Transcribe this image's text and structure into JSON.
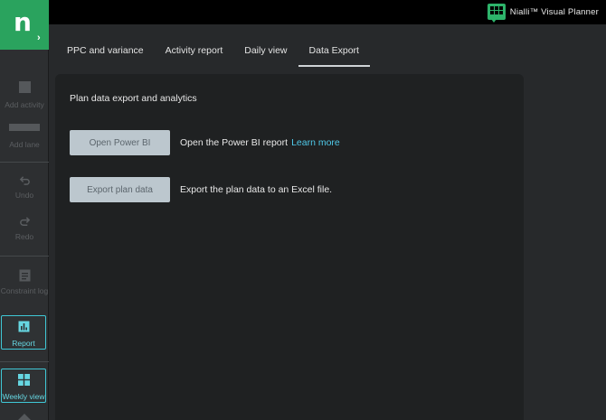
{
  "brand": {
    "name": "Nialli™ Visual Planner",
    "accent": "#2db36a"
  },
  "logo": {
    "letter": "n",
    "chevron": "›"
  },
  "sidebar": {
    "add_activity": "Add activity",
    "add_lane": "Add lane",
    "undo": "Undo",
    "redo": "Redo",
    "constraint_log": "Constraint log",
    "report": "Report",
    "weekly_view": "Weekly view"
  },
  "tabs": [
    {
      "label": "PPC and variance"
    },
    {
      "label": "Activity report"
    },
    {
      "label": "Daily view"
    },
    {
      "label": "Data Export",
      "active": true
    }
  ],
  "panel": {
    "title": "Plan data export and analytics",
    "power_bi": {
      "button": "Open Power BI",
      "text": "Open the Power BI report",
      "link": "Learn more"
    },
    "export": {
      "button": "Export plan data",
      "text": "Export the plan data to an Excel file."
    }
  },
  "colors": {
    "active_outline": "#3fc8d6",
    "link": "#4fc8e8"
  }
}
